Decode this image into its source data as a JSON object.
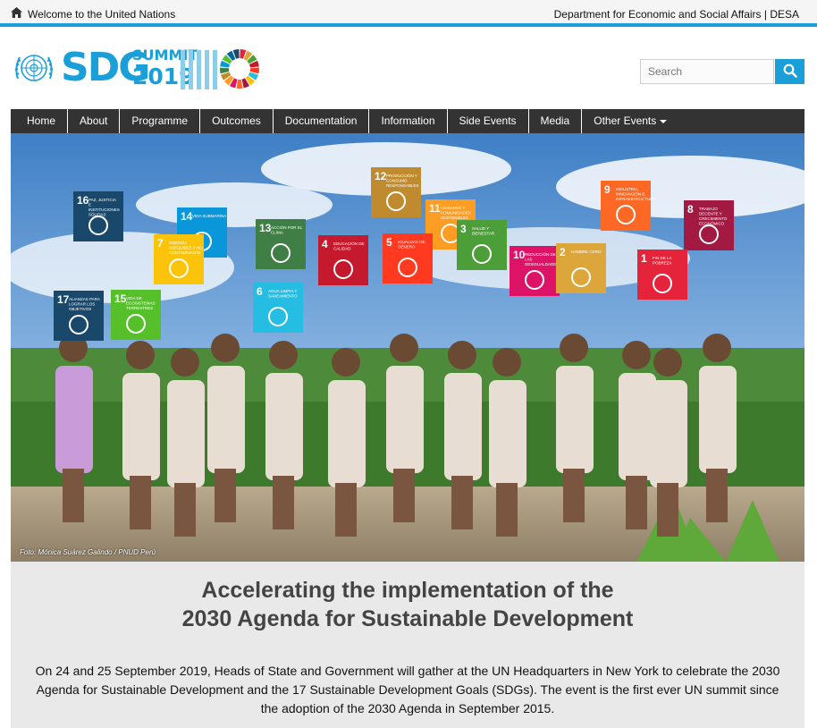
{
  "topbar": {
    "welcome": "Welcome to the United Nations",
    "department": "Department for Economic and Social Affairs | DESA"
  },
  "logo": {
    "sdg": "SDG",
    "summit": "SUMMIT",
    "year": "2019"
  },
  "search": {
    "placeholder": "Search"
  },
  "nav": {
    "items": [
      "Home",
      "About",
      "Programme",
      "Outcomes",
      "Documentation",
      "Information",
      "Side Events",
      "Media"
    ],
    "dropdown": "Other Events"
  },
  "hero": {
    "credit": "Foto: Mónica Suárez Galindo / PNUD Perú",
    "signs": [
      {
        "num": "16",
        "label": "PAZ, JUSTICIA E INSTITUCIONES SÓLIDAS",
        "color": "#19486a"
      },
      {
        "num": "14",
        "label": "VIDA SUBMARINA",
        "color": "#0a97d9"
      },
      {
        "num": "13",
        "label": "ACCIÓN POR EL CLIMA",
        "color": "#3f7e44"
      },
      {
        "num": "12",
        "label": "PRODUCCIÓN Y CONSUMO RESPONSABLES",
        "color": "#bf8b2e"
      },
      {
        "num": "11",
        "label": "CIUDADES Y COMUNIDADES SOSTENIBLES",
        "color": "#fd9d24"
      },
      {
        "num": "9",
        "label": "INDUSTRIA, INNOVACIÓN E INFRAESTRUCTURA",
        "color": "#fd6925"
      },
      {
        "num": "8",
        "label": "TRABAJO DECENTE Y CRECIMIENTO ECONÓMICO",
        "color": "#a21942"
      },
      {
        "num": "7",
        "label": "ENERGÍA ASEQUIBLE Y NO CONTAMINANTE",
        "color": "#fcc30b"
      },
      {
        "num": "4",
        "label": "EDUCACIÓN DE CALIDAD",
        "color": "#c5192d"
      },
      {
        "num": "5",
        "label": "IGUALDAD DE GÉNERO",
        "color": "#ff3a21"
      },
      {
        "num": "3",
        "label": "SALUD Y BIENESTAR",
        "color": "#4c9f38"
      },
      {
        "num": "10",
        "label": "REDUCCIÓN DE LAS DESIGUALDADES",
        "color": "#dd1367"
      },
      {
        "num": "2",
        "label": "HAMBRE CERO",
        "color": "#dda63a"
      },
      {
        "num": "1",
        "label": "FIN DE LA POBREZA",
        "color": "#e5243b"
      },
      {
        "num": "17",
        "label": "ALIANZAS PARA LOGRAR LOS OBJETIVOS",
        "color": "#19486a"
      },
      {
        "num": "15",
        "label": "VIDA DE ECOSISTEMAS TERRESTRES",
        "color": "#56c02b"
      },
      {
        "num": "6",
        "label": "AGUA LIMPIA Y SANEAMIENTO",
        "color": "#26bde2"
      }
    ]
  },
  "main": {
    "headline_line1": "Accelerating the implementation of the",
    "headline_line2": "2030 Agenda for Sustainable Development",
    "intro": "On 24 and 25 September 2019, Heads of State and Government will gather at the UN Headquarters in New York to celebrate the 2030 Agenda for Sustainable Development and the 17 Sustainable Development Goals (SDGs). The event is the first ever UN summit since the adoption of the 2030 Agenda in September 2015."
  },
  "colors": {
    "accent": "#1a9fd9",
    "nav_bg": "#333333",
    "content_bg": "#e9e9e9"
  }
}
